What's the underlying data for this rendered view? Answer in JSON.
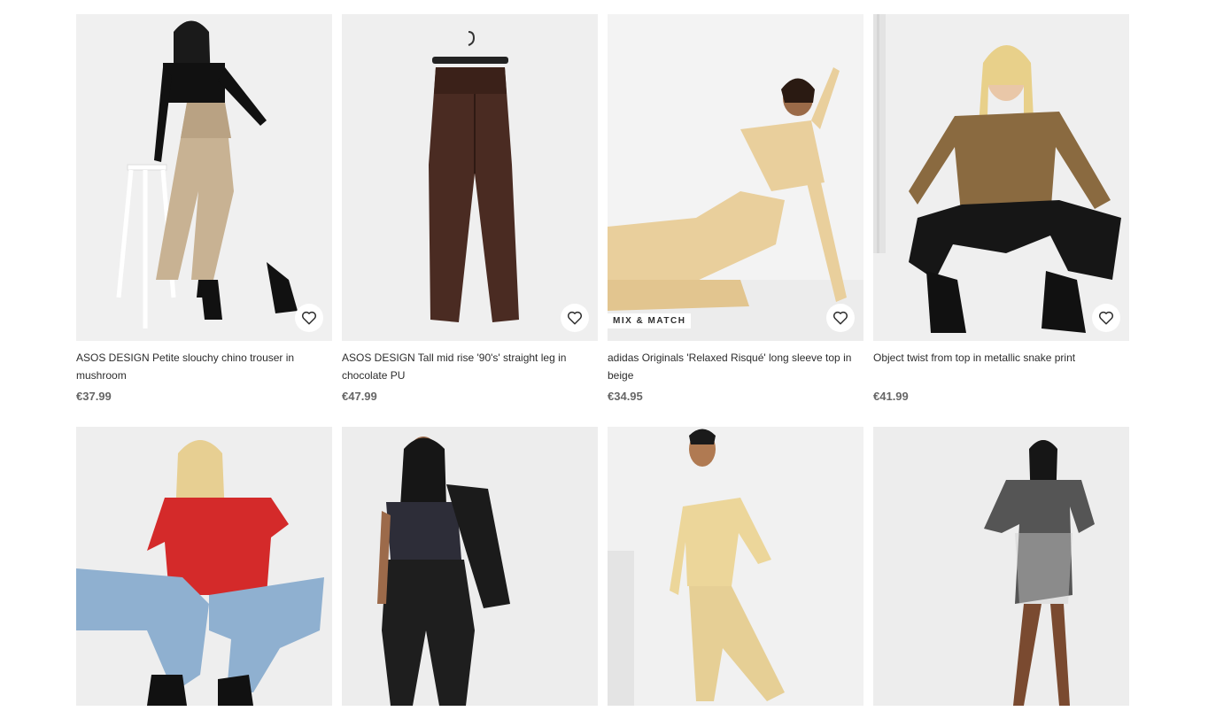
{
  "products": [
    {
      "title": "ASOS DESIGN Petite slouchy chino trouser in mushroom",
      "price": "€37.99",
      "badge": null,
      "bg": "#f0f0f0",
      "main": "#c8b293",
      "accent": "#111111"
    },
    {
      "title": "ASOS DESIGN Tall mid rise '90's' straight leg in chocolate PU",
      "price": "€47.99",
      "badge": null,
      "bg": "#efefef",
      "main": "#4a2b22",
      "accent": "#2a2a2a"
    },
    {
      "title": "adidas Originals 'Relaxed Risqué' long sleeve top in beige",
      "price": "€34.95",
      "badge": "MIX & MATCH",
      "bg": "#f3f3f3",
      "main": "#e9cf9c",
      "accent": "#3a2a20"
    },
    {
      "title": "Object twist from top in metallic snake print",
      "price": "€41.99",
      "badge": null,
      "bg": "#efefef",
      "main": "#8a6a40",
      "accent": "#161616"
    },
    {
      "title": "",
      "price": "",
      "badge": null,
      "bg": "#eeeeee",
      "main": "#d42a2a",
      "accent": "#8fb0d0"
    },
    {
      "title": "",
      "price": "",
      "badge": null,
      "bg": "#ededed",
      "main": "#2d2d38",
      "accent": "#1b1b1b"
    },
    {
      "title": "",
      "price": "",
      "badge": null,
      "bg": "#f1f1f1",
      "main": "#ecd69a",
      "accent": "#e6cf95"
    },
    {
      "title": "",
      "price": "",
      "badge": null,
      "bg": "#ededed",
      "main": "#555555",
      "accent": "#cfcfcf"
    }
  ]
}
